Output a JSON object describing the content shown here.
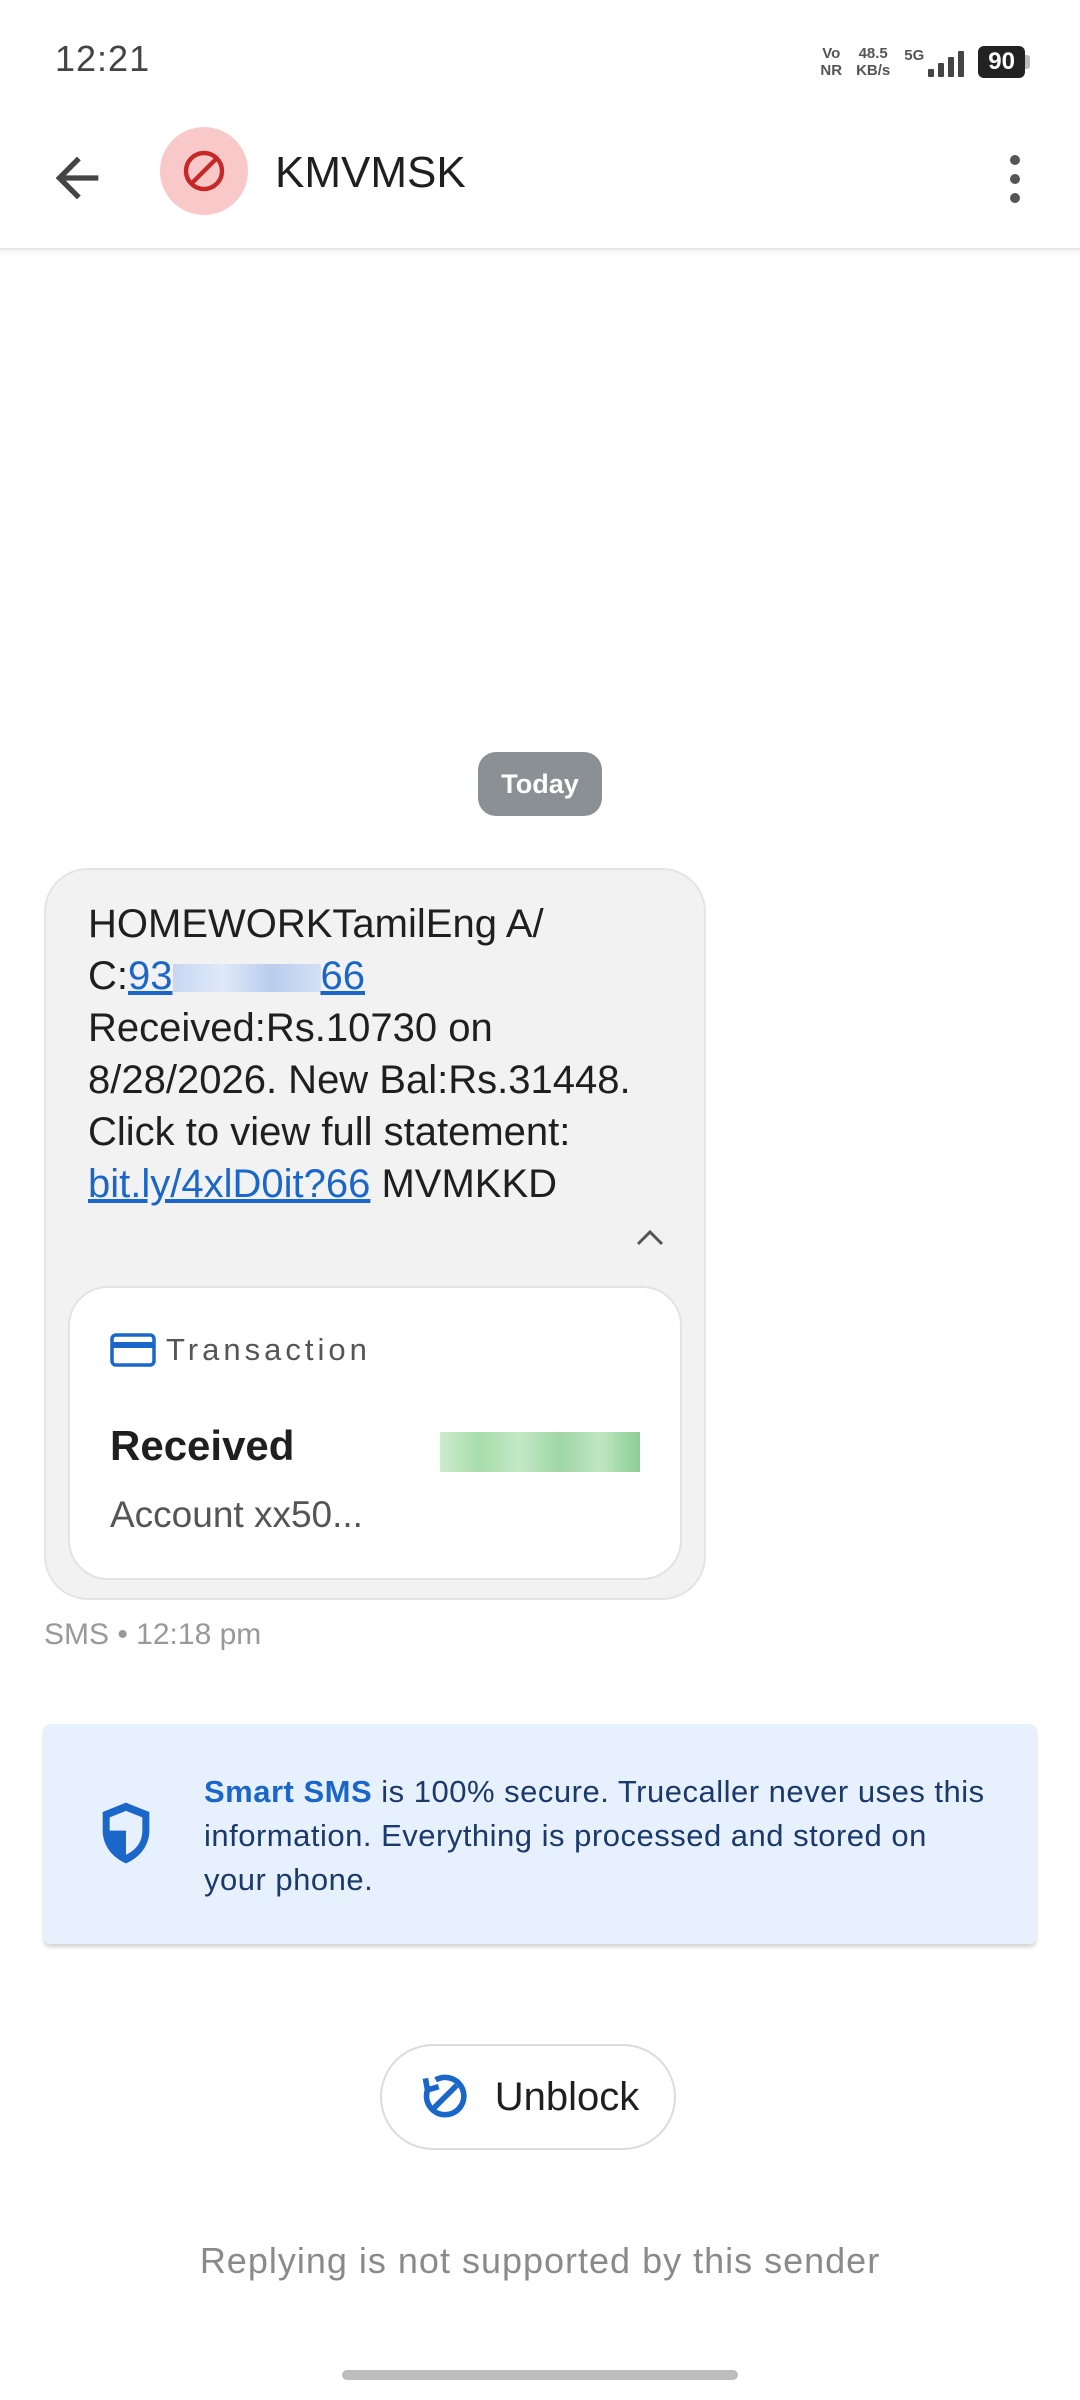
{
  "status_bar": {
    "time": "12:21",
    "vo_nr_top": "Vo",
    "vo_nr_bottom": "NR",
    "speed_value": "48.5",
    "speed_unit": "KB/s",
    "network": "5G",
    "battery": "90"
  },
  "app_bar": {
    "title": "KMVMSK",
    "back_icon": "arrow-back-icon",
    "avatar_icon": "blocked-icon",
    "menu_icon": "more-vert-icon"
  },
  "conversation": {
    "date_chip": "Today",
    "message": {
      "text_line1": "HOMEWORKTamilEng A/",
      "text_prefix_ac": "C:",
      "ac_start": "93",
      "ac_end": "66",
      "text_body": "Received:Rs.10730 on 8/28/2026. New Bal:Rs.31448. Click to view full statement: ",
      "link_text": "bit.ly/4xlD0it?66",
      "text_suffix": " MVMKKD"
    },
    "card": {
      "label": "Transaction",
      "status": "Received",
      "account": "Account xx50..."
    },
    "meta": "SMS • 12:18 pm"
  },
  "info_box": {
    "strong": "Smart SMS",
    "text": " is 100% secure. Truecaller never uses this information. Everything is processed and stored on your phone."
  },
  "unblock_button": {
    "label": "Unblock"
  },
  "reply_note": "Replying is not supported by this sender",
  "colors": {
    "accent": "#1a66c9",
    "avatar_bg": "#f9c9c9",
    "blocked_red": "#c62828",
    "info_bg": "#e7f0fd"
  }
}
